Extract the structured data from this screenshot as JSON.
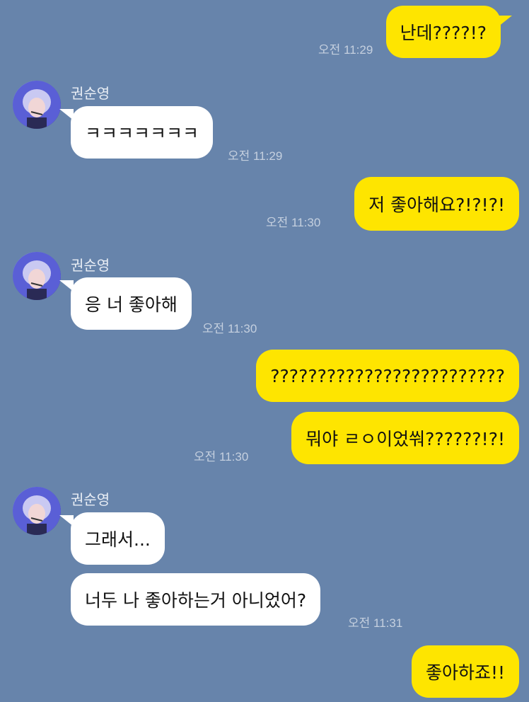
{
  "contact": {
    "name": "권순영"
  },
  "messages": [
    {
      "side": "me",
      "text": "난데????!?",
      "time": "오전 11:29"
    },
    {
      "side": "them",
      "text": "ㅋㅋㅋㅋㅋㅋㅋ",
      "time": "오전 11:29"
    },
    {
      "side": "me",
      "text": "저 좋아해요?!?!?!",
      "time": "오전 11:30"
    },
    {
      "side": "them",
      "text": "응 너 좋아해",
      "time": "오전 11:30"
    },
    {
      "side": "me",
      "text": "?????????????????????????",
      "time": ""
    },
    {
      "side": "me",
      "text": "뭐야 ㄹㅇ이었쒀??????!?!",
      "time": "오전 11:30"
    },
    {
      "side": "them",
      "text": "그래서...",
      "time": ""
    },
    {
      "side": "them",
      "text": "너두 나 좋아하는거 아니었어?",
      "time": "오전 11:31"
    },
    {
      "side": "me",
      "text": "좋아하죠!!",
      "time": ""
    }
  ],
  "colors": {
    "background": "#6784ab",
    "my_bubble": "#fee500",
    "their_bubble": "#ffffff",
    "timestamp": "#c5d0df"
  }
}
